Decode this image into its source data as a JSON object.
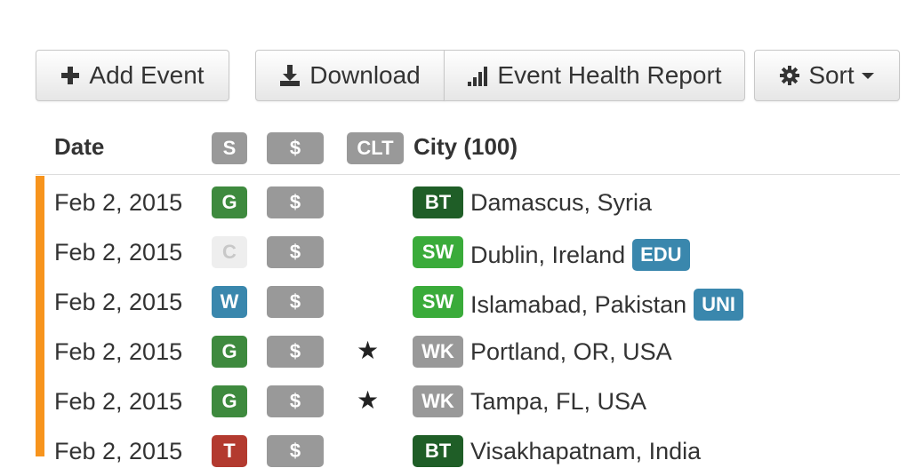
{
  "toolbar": {
    "add_label": "Add Event",
    "download_label": "Download",
    "health_label": "Event Health Report",
    "sort_label": "Sort"
  },
  "table": {
    "header_date": "Date",
    "header_s": "S",
    "header_dollar": "$",
    "header_clt": "CLT",
    "header_city": "City (100)"
  },
  "colors": {
    "green": "#3e8a3e",
    "light_gray": "#eeeeee",
    "blue": "#3a87ad",
    "red": "#b33a2f",
    "gray": "#999999",
    "dark_green": "#1f5e27",
    "bright_green": "#3aab3a",
    "accent": "#f7941d"
  },
  "rows": [
    {
      "date": "Feb 2, 2015",
      "status": "G",
      "status_color": "#3e8a3e",
      "dollar": "$",
      "star": "",
      "code": "BT",
      "code_color": "#1f5e27",
      "city": "Damascus, Syria",
      "tag": ""
    },
    {
      "date": "Feb 2, 2015",
      "status": "C",
      "status_color": "#eeeeee",
      "dollar": "$",
      "star": "",
      "code": "SW",
      "code_color": "#3aab3a",
      "city": "Dublin, Ireland",
      "tag": "EDU"
    },
    {
      "date": "Feb 2, 2015",
      "status": "W",
      "status_color": "#3a87ad",
      "dollar": "$",
      "star": "",
      "code": "SW",
      "code_color": "#3aab3a",
      "city": "Islamabad, Pakistan",
      "tag": "UNI"
    },
    {
      "date": "Feb 2, 2015",
      "status": "G",
      "status_color": "#3e8a3e",
      "dollar": "$",
      "star": "★",
      "code": "WK",
      "code_color": "#999999",
      "city": "Portland, OR, USA",
      "tag": ""
    },
    {
      "date": "Feb 2, 2015",
      "status": "G",
      "status_color": "#3e8a3e",
      "dollar": "$",
      "star": "★",
      "code": "WK",
      "code_color": "#999999",
      "city": "Tampa, FL, USA",
      "tag": ""
    },
    {
      "date": "Feb 2, 2015",
      "status": "T",
      "status_color": "#b33a2f",
      "dollar": "$",
      "star": "",
      "code": "BT",
      "code_color": "#1f5e27",
      "city": "Visakhapatnam, India",
      "tag": ""
    }
  ]
}
